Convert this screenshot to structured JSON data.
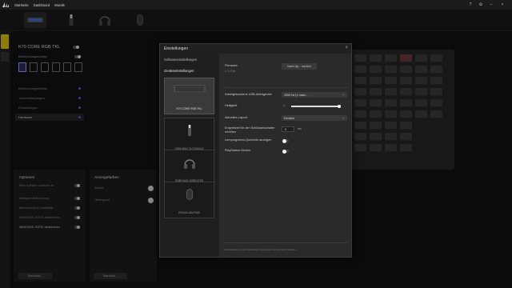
{
  "topbar": {
    "menu": [
      "Startseite",
      "Dashboard",
      "Murals"
    ],
    "logo_icon": "corsair-sails-icon"
  },
  "left_panel": {
    "device_name": "K70 CORE RGB TKL",
    "subtitle": "Beleuchtungsmodus",
    "menu": [
      "Beleuchtungseffekte",
      "Tastenbelegungen",
      "Einstellungen",
      "Hardware"
    ],
    "menu_selected_index": 3
  },
  "options": {
    "heading": "Optionen",
    "rows": [
      "Beim Aufladen zulassen ab",
      "Hardware-Beleuchtung",
      "Beleuchtung bei Inaktivität",
      "WINDOWS-TASTE deaktivieren"
    ],
    "button": "Standard..."
  },
  "colors": {
    "heading": "Anzeigefarben",
    "rows": [
      "Akzent",
      "Hintergrund"
    ],
    "button": "Standard..."
  },
  "dialog": {
    "title": "Einstellungen",
    "side_tabs": {
      "software": "Softwareeinstellungen",
      "device": "Geräteeinstellungen"
    },
    "devices": [
      {
        "label": "K70 CORE RGB TKL",
        "icon": "keyboard-icon"
      },
      {
        "label": "HS80 MAX 2x DONGLE",
        "icon": "dongle-icon"
      },
      {
        "label": "HS80 MAX WIRELESS",
        "icon": "headset-icon"
      },
      {
        "label": "IRONCLAW RGB",
        "icon": "mouse-icon"
      }
    ],
    "selected_device_index": 0,
    "firmware": {
      "label": "Firmware",
      "version": "v. 1.4.16",
      "button": "Nach Up... suchen"
    },
    "usb_poll": {
      "label": "Kabelgebundene USB-Abfrageɾate",
      "value": "1000 Hz (1 msec..."
    },
    "brightness": {
      "label": "Helligkeit",
      "level_percent": 100
    },
    "layout": {
      "label": "Aktuelles Layout",
      "value": "Deutsch"
    },
    "debounce": {
      "label": "Entprellzeit für den Schlüsselschalter erhöhen",
      "value": "0",
      "unit": "ms"
    },
    "toggles": [
      {
        "label": "Lernprogramm-Quickinfo anzeigen",
        "on": false
      },
      {
        "label": "PlayStation-Modus",
        "on": false
      }
    ],
    "footnote": "Einstellungen werden automatisch angewendet und sind sofort wirksam."
  }
}
